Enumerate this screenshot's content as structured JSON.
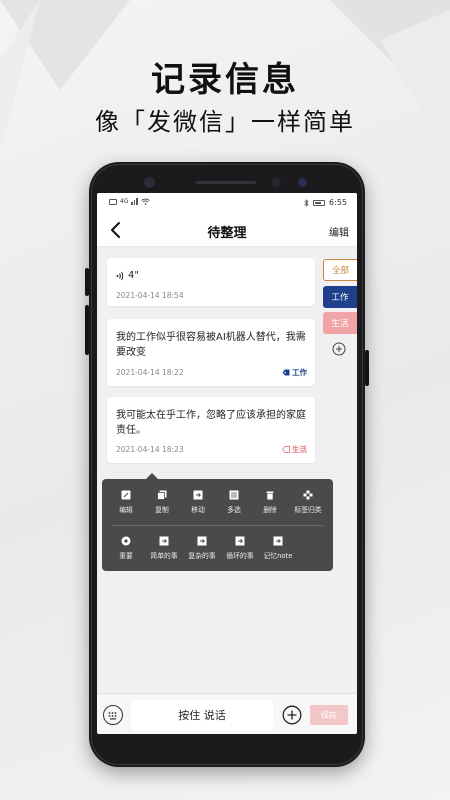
{
  "promo": {
    "headline": "记录信息",
    "subheadline": "像「发微信」一样简单"
  },
  "status_bar": {
    "left_icons": [
      "hd-icon",
      "signal-icon",
      "wifi-icon"
    ],
    "network_label": "4G",
    "time": "6:55",
    "right_icons": [
      "bluetooth-icon",
      "battery-icon"
    ]
  },
  "nav": {
    "back_icon": "chevron-left-icon",
    "title": "待整理",
    "edit_label": "编辑"
  },
  "categories": [
    {
      "label": "全部",
      "state": "outlined",
      "color": "#c8873f"
    },
    {
      "label": "工作",
      "state": "filled",
      "color": "#1f3f8c"
    },
    {
      "label": "生活",
      "state": "filled",
      "color": "#f0a4a6"
    }
  ],
  "add_category_icon": "plus-circle-icon",
  "notes": [
    {
      "kind": "voice",
      "text": "4\"",
      "time": "2021-04-14 18:54",
      "tag": ""
    },
    {
      "kind": "text",
      "text": "我的工作似乎很容易被AI机器人替代，我需要改变",
      "time": "2021-04-14 18:22",
      "tag": "工作",
      "tag_color": "#1f3f8c"
    },
    {
      "kind": "text",
      "text": "我可能太在乎工作，忽略了应该承担的家庭责任。",
      "time": "2021-04-14 18:23",
      "tag": "生活",
      "tag_color": "#e57f86"
    }
  ],
  "context_menu": {
    "row1": [
      {
        "label": "编辑",
        "icon": "edit-icon"
      },
      {
        "label": "复制",
        "icon": "copy-icon"
      },
      {
        "label": "移动",
        "icon": "move-icon"
      },
      {
        "label": "多选",
        "icon": "multiselect-icon"
      },
      {
        "label": "删除",
        "icon": "trash-icon"
      },
      {
        "label": "标签归类",
        "icon": "tag-sort-icon"
      }
    ],
    "row2": [
      {
        "label": "重要",
        "icon": "important-icon"
      },
      {
        "label": "简单的事",
        "icon": "simple-task-icon"
      },
      {
        "label": "复杂的事",
        "icon": "complex-task-icon"
      },
      {
        "label": "循环的事",
        "icon": "recurring-task-icon"
      },
      {
        "label": "记忆note",
        "icon": "memory-note-icon"
      }
    ]
  },
  "bottom_bar": {
    "keyboard_icon": "keyboard-icon",
    "talk_label": "按住 说话",
    "add_icon": "plus-circle-icon",
    "save_label": "保存",
    "save_color": "#f3c6c8"
  }
}
